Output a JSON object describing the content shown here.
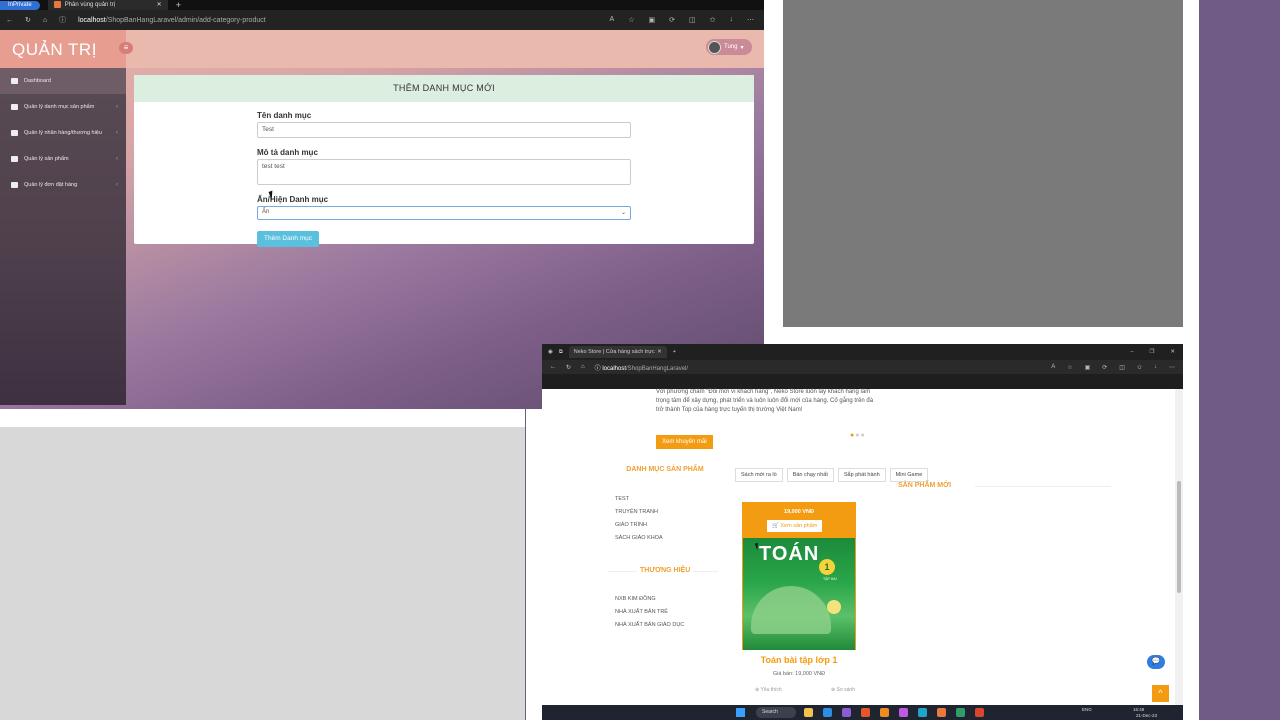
{
  "admin": {
    "tab_private": "InPrivate",
    "tab_title": "Phân vùng quản trị",
    "tab_close": "✕",
    "new_tab": "+",
    "url_host": "localhost",
    "url_path": "/ShopBanHangLaravel/admin/add-category-product",
    "brand": "QUẢN TRỊ",
    "user_name": "Tung",
    "sidebar": [
      "Dashboard",
      "Quản lý danh mục sản phẩm",
      "Quản lý nhãn hàng/thương hiệu",
      "Quản lý sản phẩm",
      "Quản lý đơn đặt hàng"
    ],
    "card_title": "THÊM DANH MỤC MỚI",
    "form": {
      "name_label": "Tên danh mục",
      "name_value": "Test",
      "desc_label": "Mô tả danh mục",
      "desc_value": "test test",
      "status_label": "Ẩn/Hiện Danh mục",
      "status_value": "Ẩn",
      "submit_label": "Thêm Danh mục"
    }
  },
  "store": {
    "tab_title": "Neko Store | Cửa hàng sách trực",
    "url_host": "localhost",
    "url_path": "/ShopBanHangLaravel/",
    "intro_text": "Với phương châm \"Đổi mới vì khách hàng\", Neko Store luôn lấy khách hàng làm trọng tâm để xây dựng, phát triển và luôn luôn đổi mới của hàng. Cố gắng trên đà trở thành Top của hàng trực tuyến thị trường Việt Nam!",
    "promo_button": "Xem khuyến mãi",
    "category_title": "DANH MỤC SẢN PHẨM",
    "categories": [
      "TEST",
      "TRUYỆN TRANH",
      "GIÁO TRÌNH",
      "SÁCH GIÁO KHOA"
    ],
    "brand_title": "THƯƠNG HIỆU",
    "brands": [
      "NXB KIM ĐỒNG",
      "NHÀ XUẤT BẢN TRẺ",
      "NHÀ XUẤT BẢN GIÁO DỤC"
    ],
    "tabs": [
      "Sách mới ra lò",
      "Bán chạy nhất",
      "Sắp phát hành",
      "Mini Game"
    ],
    "new_products_title": "SẢN PHẨM MỚI",
    "product": {
      "price_top": "19,000 VNĐ",
      "view_button": "Xem sản phẩm",
      "cover_title": "TOÁN",
      "cover_number": "1",
      "cover_sub": "TẬP HAI",
      "name": "Toán bài tập lớp 1",
      "price": "Giá bán: 19,000 VNĐ",
      "wishlist": "Yêu thích",
      "compare": "So sánh"
    },
    "taskbar": {
      "search": "Search",
      "lang": "ENG",
      "time": "16:49",
      "date": "21-Dec-23"
    }
  }
}
